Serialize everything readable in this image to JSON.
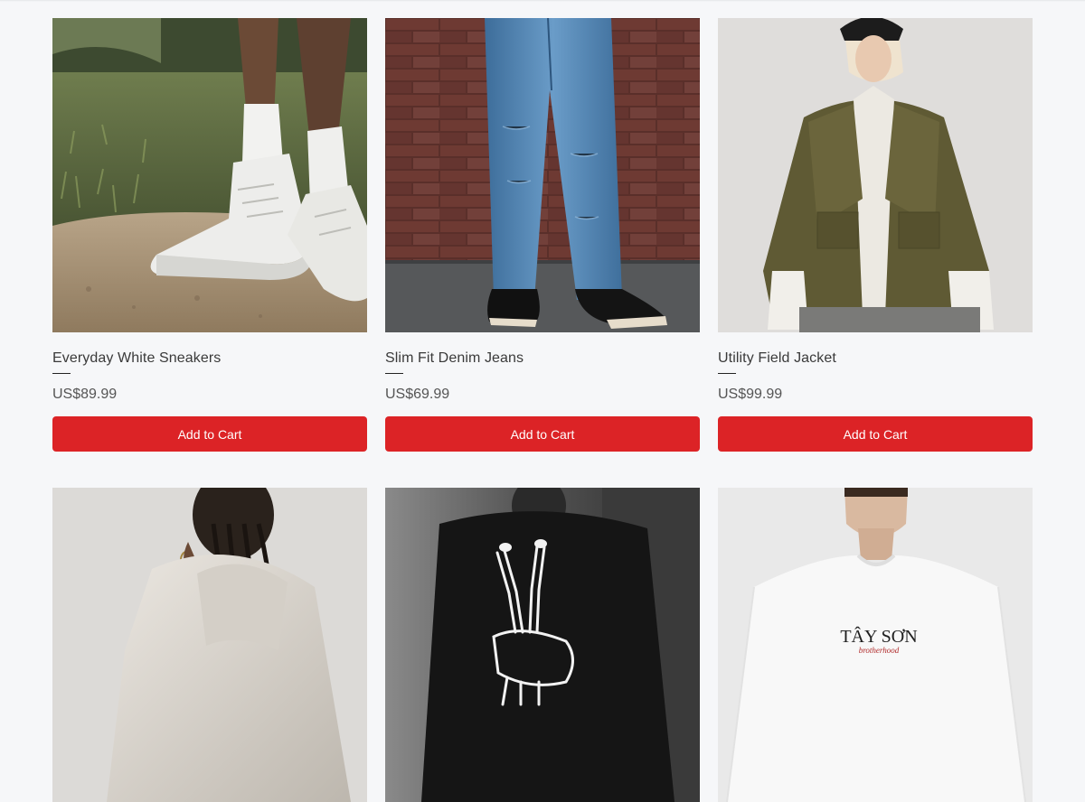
{
  "products": [
    {
      "name": "Everyday White Sneakers",
      "price": "US$89.99",
      "button_label": "Add to Cart",
      "image": "white-sneakers-photo"
    },
    {
      "name": "Slim Fit Denim Jeans",
      "price": "US$69.99",
      "button_label": "Add to Cart",
      "image": "denim-jeans-photo"
    },
    {
      "name": "Utility Field Jacket",
      "price": "US$99.99",
      "button_label": "Add to Cart",
      "image": "field-jacket-photo"
    },
    {
      "name": "",
      "price": "",
      "button_label": "",
      "image": "hoodie-braids-photo"
    },
    {
      "name": "",
      "price": "",
      "button_label": "",
      "image": "skeleton-peace-tee-photo"
    },
    {
      "name": "",
      "price": "",
      "button_label": "",
      "image": "tay-son-white-tee-photo",
      "print_text": "TÂY SƠN",
      "print_subtext": "brotherhood"
    }
  ],
  "colors": {
    "accent": "#dc2326",
    "background": "#f6f7f9"
  }
}
